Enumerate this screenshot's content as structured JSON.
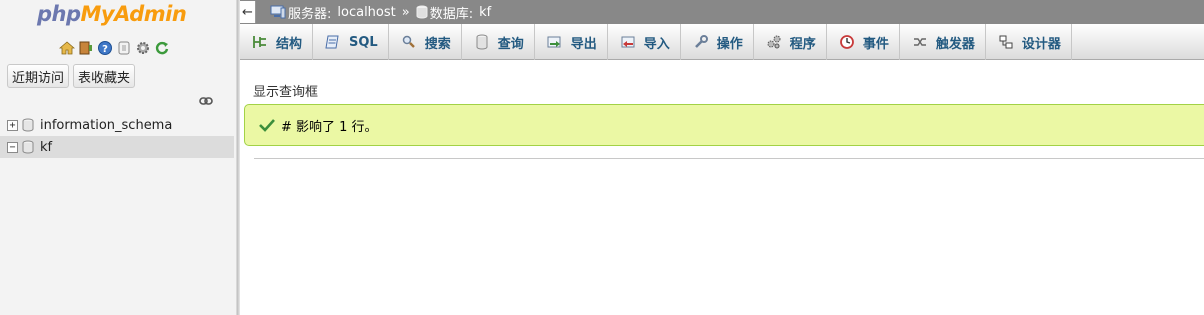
{
  "logo": {
    "part1": "php",
    "part2": "MyAdmin"
  },
  "nav": {
    "quick_icons": [
      "home-icon",
      "exit-icon",
      "help-icon",
      "docs-icon",
      "settings-icon",
      "reload-icon"
    ],
    "buttons": {
      "recent": "近期访问",
      "favorites": "表收藏夹"
    },
    "tree": [
      {
        "name": "information_schema",
        "expander": "+",
        "selected": false
      },
      {
        "name": "kf",
        "expander": "−",
        "selected": true
      }
    ]
  },
  "topbar": {
    "back": "←",
    "server_label": "服务器:",
    "server_name": "localhost",
    "separator": "»",
    "db_label": "数据库:",
    "db_name": "kf"
  },
  "menu": [
    {
      "id": "structure",
      "label": "结构",
      "icon": "structure-icon"
    },
    {
      "id": "sql",
      "label": "SQL",
      "icon": "sql-icon"
    },
    {
      "id": "search",
      "label": "搜索",
      "icon": "search-icon"
    },
    {
      "id": "query",
      "label": "查询",
      "icon": "query-icon"
    },
    {
      "id": "export",
      "label": "导出",
      "icon": "export-icon"
    },
    {
      "id": "import",
      "label": "导入",
      "icon": "import-icon"
    },
    {
      "id": "operations",
      "label": "操作",
      "icon": "wrench-icon"
    },
    {
      "id": "routines",
      "label": "程序",
      "icon": "routines-icon"
    },
    {
      "id": "events",
      "label": "事件",
      "icon": "clock-icon"
    },
    {
      "id": "triggers",
      "label": "触发器",
      "icon": "trigger-icon"
    },
    {
      "id": "designer",
      "label": "设计器",
      "icon": "designer-icon"
    }
  ],
  "main": {
    "show_query_label": "显示查询框",
    "message": "# 影响了 1 行。"
  },
  "colors": {
    "logo_php": "#6c78af",
    "logo_myadmin": "#f89c0e",
    "topbar_bg": "#888888",
    "tab_text": "#235a81",
    "success_bg": "#ebf8a4",
    "success_border": "#a2d246"
  }
}
